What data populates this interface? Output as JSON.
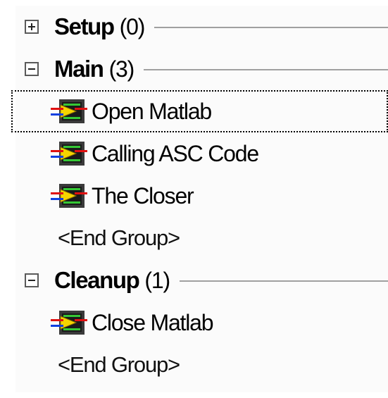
{
  "groups": [
    {
      "name": "Setup",
      "count": "(0)",
      "expanded": false
    },
    {
      "name": "Main",
      "count": "(3)",
      "expanded": true
    },
    {
      "name": "Cleanup",
      "count": "(1)",
      "expanded": true
    }
  ],
  "steps": {
    "main": [
      {
        "label": "Open Matlab",
        "icon": "matlab-step-icon",
        "selected": true
      },
      {
        "label": "Calling ASC Code",
        "icon": "matlab-step-icon",
        "selected": false
      },
      {
        "label": "The Closer",
        "icon": "matlab-step-icon",
        "selected": false
      }
    ],
    "cleanup": [
      {
        "label": "Close Matlab",
        "icon": "matlab-step-icon",
        "selected": false
      }
    ]
  },
  "end_group_label": "<End Group>",
  "colors": {
    "panel_background": "#fbfbfb",
    "group_line": "#a0a0a0",
    "icon_screen": "#1a1a1a",
    "icon_screen_green": "#35c735",
    "icon_arrow_yellow": "#f5d400",
    "wire_red": "#e01010",
    "wire_blue": "#1040e0"
  }
}
